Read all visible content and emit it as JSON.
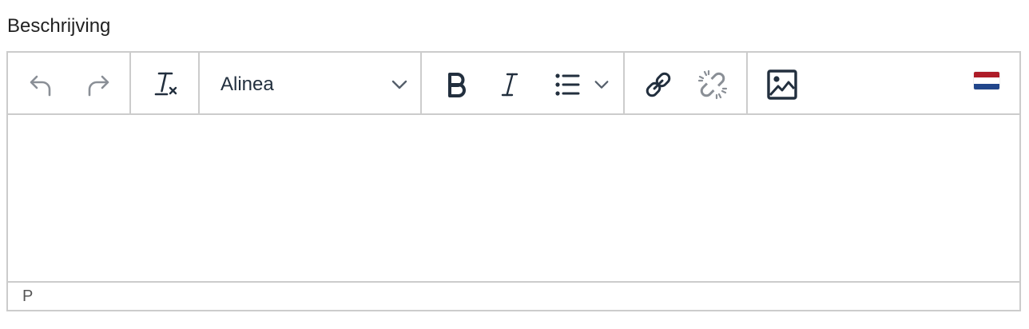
{
  "field": {
    "label": "Beschrijving"
  },
  "toolbar": {
    "undo_icon": "undo-icon",
    "redo_icon": "redo-icon",
    "clear_format_icon": "remove-format-icon",
    "block_format": {
      "selected": "Alinea"
    },
    "bold_icon": "bold-icon",
    "italic_icon": "italic-icon",
    "bullet_list_icon": "bullet-list-icon",
    "link_icon": "link-icon",
    "unlink_icon": "unlink-icon",
    "image_icon": "image-icon",
    "language_icon": "netherlands-flag-icon",
    "flag_colors": [
      "#ae1c28",
      "#ffffff",
      "#21468b"
    ]
  },
  "editor": {
    "content": ""
  },
  "statusbar": {
    "path": "P"
  },
  "colors": {
    "icon": "#222f3e",
    "icon_disabled": "#8a8f96",
    "border": "#cccccc"
  }
}
